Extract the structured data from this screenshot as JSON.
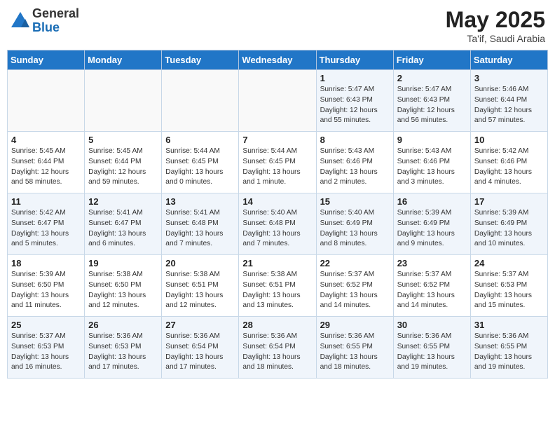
{
  "logo": {
    "general": "General",
    "blue": "Blue"
  },
  "title": {
    "month_year": "May 2025",
    "location": "Ta'if, Saudi Arabia"
  },
  "weekdays": [
    "Sunday",
    "Monday",
    "Tuesday",
    "Wednesday",
    "Thursday",
    "Friday",
    "Saturday"
  ],
  "weeks": [
    [
      {
        "day": "",
        "content": ""
      },
      {
        "day": "",
        "content": ""
      },
      {
        "day": "",
        "content": ""
      },
      {
        "day": "",
        "content": ""
      },
      {
        "day": "1",
        "content": "Sunrise: 5:47 AM\nSunset: 6:43 PM\nDaylight: 12 hours\nand 55 minutes."
      },
      {
        "day": "2",
        "content": "Sunrise: 5:47 AM\nSunset: 6:43 PM\nDaylight: 12 hours\nand 56 minutes."
      },
      {
        "day": "3",
        "content": "Sunrise: 5:46 AM\nSunset: 6:44 PM\nDaylight: 12 hours\nand 57 minutes."
      }
    ],
    [
      {
        "day": "4",
        "content": "Sunrise: 5:45 AM\nSunset: 6:44 PM\nDaylight: 12 hours\nand 58 minutes."
      },
      {
        "day": "5",
        "content": "Sunrise: 5:45 AM\nSunset: 6:44 PM\nDaylight: 12 hours\nand 59 minutes."
      },
      {
        "day": "6",
        "content": "Sunrise: 5:44 AM\nSunset: 6:45 PM\nDaylight: 13 hours\nand 0 minutes."
      },
      {
        "day": "7",
        "content": "Sunrise: 5:44 AM\nSunset: 6:45 PM\nDaylight: 13 hours\nand 1 minute."
      },
      {
        "day": "8",
        "content": "Sunrise: 5:43 AM\nSunset: 6:46 PM\nDaylight: 13 hours\nand 2 minutes."
      },
      {
        "day": "9",
        "content": "Sunrise: 5:43 AM\nSunset: 6:46 PM\nDaylight: 13 hours\nand 3 minutes."
      },
      {
        "day": "10",
        "content": "Sunrise: 5:42 AM\nSunset: 6:46 PM\nDaylight: 13 hours\nand 4 minutes."
      }
    ],
    [
      {
        "day": "11",
        "content": "Sunrise: 5:42 AM\nSunset: 6:47 PM\nDaylight: 13 hours\nand 5 minutes."
      },
      {
        "day": "12",
        "content": "Sunrise: 5:41 AM\nSunset: 6:47 PM\nDaylight: 13 hours\nand 6 minutes."
      },
      {
        "day": "13",
        "content": "Sunrise: 5:41 AM\nSunset: 6:48 PM\nDaylight: 13 hours\nand 7 minutes."
      },
      {
        "day": "14",
        "content": "Sunrise: 5:40 AM\nSunset: 6:48 PM\nDaylight: 13 hours\nand 7 minutes."
      },
      {
        "day": "15",
        "content": "Sunrise: 5:40 AM\nSunset: 6:49 PM\nDaylight: 13 hours\nand 8 minutes."
      },
      {
        "day": "16",
        "content": "Sunrise: 5:39 AM\nSunset: 6:49 PM\nDaylight: 13 hours\nand 9 minutes."
      },
      {
        "day": "17",
        "content": "Sunrise: 5:39 AM\nSunset: 6:49 PM\nDaylight: 13 hours\nand 10 minutes."
      }
    ],
    [
      {
        "day": "18",
        "content": "Sunrise: 5:39 AM\nSunset: 6:50 PM\nDaylight: 13 hours\nand 11 minutes."
      },
      {
        "day": "19",
        "content": "Sunrise: 5:38 AM\nSunset: 6:50 PM\nDaylight: 13 hours\nand 12 minutes."
      },
      {
        "day": "20",
        "content": "Sunrise: 5:38 AM\nSunset: 6:51 PM\nDaylight: 13 hours\nand 12 minutes."
      },
      {
        "day": "21",
        "content": "Sunrise: 5:38 AM\nSunset: 6:51 PM\nDaylight: 13 hours\nand 13 minutes."
      },
      {
        "day": "22",
        "content": "Sunrise: 5:37 AM\nSunset: 6:52 PM\nDaylight: 13 hours\nand 14 minutes."
      },
      {
        "day": "23",
        "content": "Sunrise: 5:37 AM\nSunset: 6:52 PM\nDaylight: 13 hours\nand 14 minutes."
      },
      {
        "day": "24",
        "content": "Sunrise: 5:37 AM\nSunset: 6:53 PM\nDaylight: 13 hours\nand 15 minutes."
      }
    ],
    [
      {
        "day": "25",
        "content": "Sunrise: 5:37 AM\nSunset: 6:53 PM\nDaylight: 13 hours\nand 16 minutes."
      },
      {
        "day": "26",
        "content": "Sunrise: 5:36 AM\nSunset: 6:53 PM\nDaylight: 13 hours\nand 17 minutes."
      },
      {
        "day": "27",
        "content": "Sunrise: 5:36 AM\nSunset: 6:54 PM\nDaylight: 13 hours\nand 17 minutes."
      },
      {
        "day": "28",
        "content": "Sunrise: 5:36 AM\nSunset: 6:54 PM\nDaylight: 13 hours\nand 18 minutes."
      },
      {
        "day": "29",
        "content": "Sunrise: 5:36 AM\nSunset: 6:55 PM\nDaylight: 13 hours\nand 18 minutes."
      },
      {
        "day": "30",
        "content": "Sunrise: 5:36 AM\nSunset: 6:55 PM\nDaylight: 13 hours\nand 19 minutes."
      },
      {
        "day": "31",
        "content": "Sunrise: 5:36 AM\nSunset: 6:55 PM\nDaylight: 13 hours\nand 19 minutes."
      }
    ]
  ]
}
